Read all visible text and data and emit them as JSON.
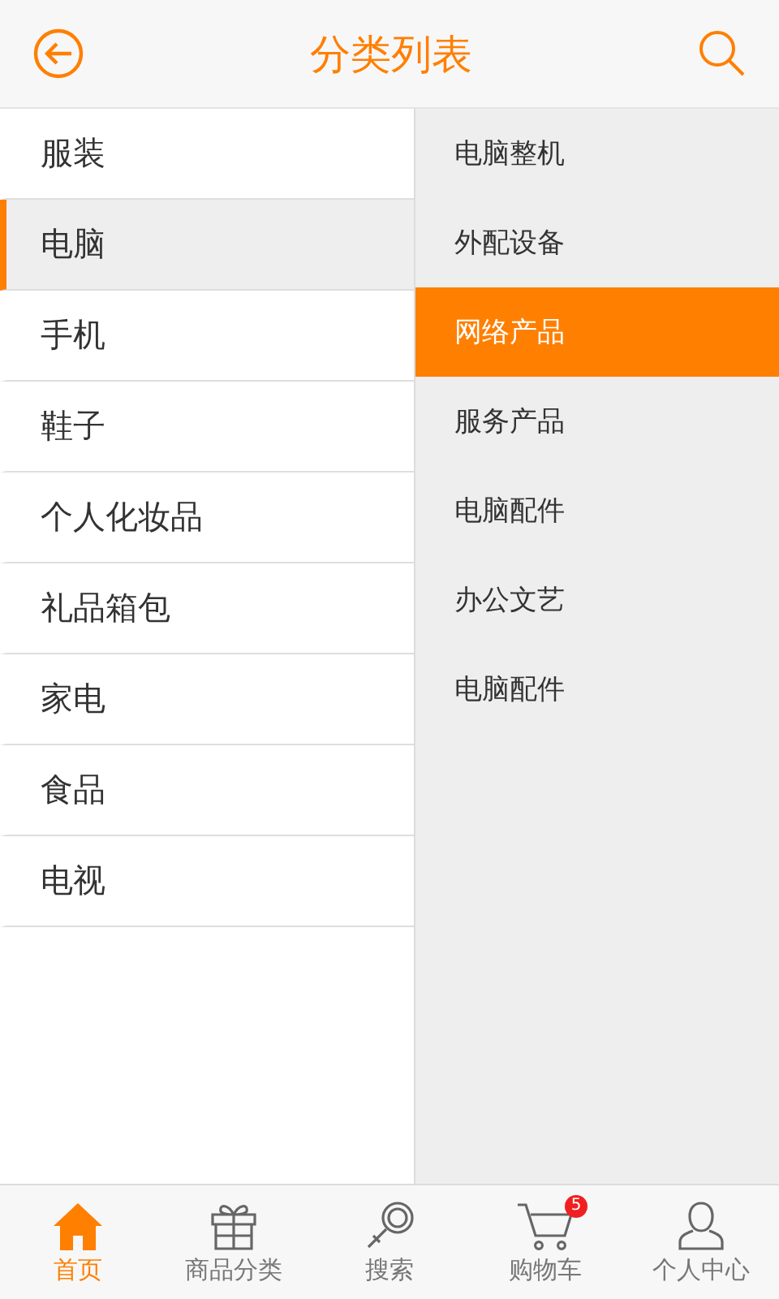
{
  "header": {
    "title": "分类列表"
  },
  "categories": [
    {
      "label": "服装",
      "selected": false
    },
    {
      "label": "电脑",
      "selected": true
    },
    {
      "label": "手机",
      "selected": false
    },
    {
      "label": "鞋子",
      "selected": false
    },
    {
      "label": "个人化妆品",
      "selected": false
    },
    {
      "label": "礼品箱包",
      "selected": false
    },
    {
      "label": "家电",
      "selected": false
    },
    {
      "label": "食品",
      "selected": false
    },
    {
      "label": "电视",
      "selected": false
    }
  ],
  "subcategories": [
    {
      "label": "电脑整机",
      "selected": false
    },
    {
      "label": "外配设备",
      "selected": false
    },
    {
      "label": "网络产品",
      "selected": true
    },
    {
      "label": "服务产品",
      "selected": false
    },
    {
      "label": "电脑配件",
      "selected": false
    },
    {
      "label": "办公文艺",
      "selected": false
    },
    {
      "label": "电脑配件",
      "selected": false
    }
  ],
  "tab_bar": [
    {
      "kind": "home",
      "label": "首页",
      "selected": true
    },
    {
      "kind": "gift",
      "label": "商品分类",
      "selected": false
    },
    {
      "kind": "search",
      "label": "搜索",
      "selected": false
    },
    {
      "kind": "cart",
      "label": "购物车",
      "selected": false,
      "badge": "5"
    },
    {
      "kind": "person",
      "label": "个人中心",
      "selected": false
    }
  ]
}
